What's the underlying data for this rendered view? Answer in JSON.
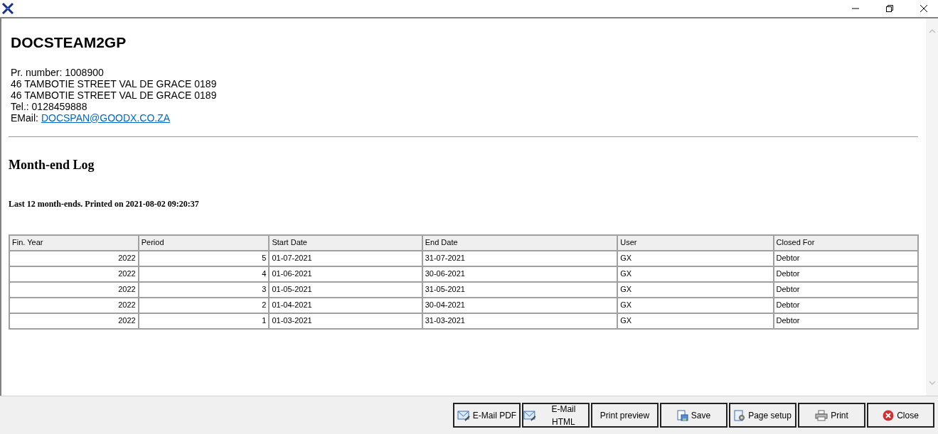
{
  "header": {
    "company": "DOCSTEAM2GP",
    "lines": [
      "Pr. number: 1008900",
      "46 TAMBOTIE STREET VAL DE GRACE 0189",
      "46 TAMBOTIE STREET VAL DE GRACE 0189",
      "Tel.: 0128459888"
    ],
    "email_label": "EMail:",
    "email": "DOCSPAN@GOODX.CO.ZA"
  },
  "report": {
    "title": "Month-end Log",
    "subtitle": "Last 12 month-ends. Printed on 2021-08-02 09:20:37"
  },
  "table": {
    "columns": [
      "Fin. Year",
      "Period",
      "Start Date",
      "End Date",
      "User",
      "Closed For"
    ],
    "rows": [
      [
        "2022",
        "5",
        "01-07-2021",
        "31-07-2021",
        "GX",
        "Debtor"
      ],
      [
        "2022",
        "4",
        "01-06-2021",
        "30-06-2021",
        "GX",
        "Debtor"
      ],
      [
        "2022",
        "3",
        "01-05-2021",
        "31-05-2021",
        "GX",
        "Debtor"
      ],
      [
        "2022",
        "2",
        "01-04-2021",
        "30-04-2021",
        "GX",
        "Debtor"
      ],
      [
        "2022",
        "1",
        "01-03-2021",
        "31-03-2021",
        "GX",
        "Debtor"
      ]
    ]
  },
  "buttons": [
    {
      "label": "E-Mail PDF",
      "kind": "mail"
    },
    {
      "label": "E-Mail HTML",
      "kind": "mail"
    },
    {
      "label": "Print preview",
      "kind": "plain"
    },
    {
      "label": "Save",
      "kind": "save"
    },
    {
      "label": "Page setup",
      "kind": "page"
    },
    {
      "label": "Print",
      "kind": "print"
    },
    {
      "label": "Close",
      "kind": "close"
    }
  ]
}
